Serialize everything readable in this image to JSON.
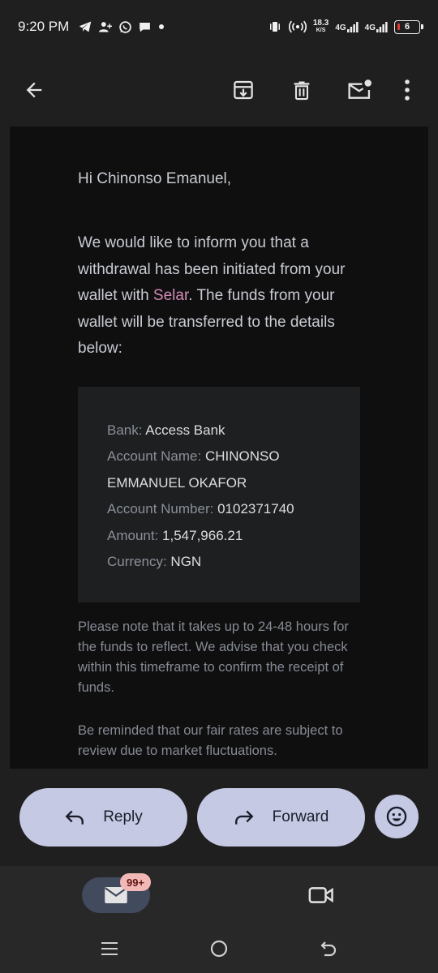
{
  "status_bar": {
    "time": "9:20 PM",
    "net_speed_value": "18.3",
    "net_speed_unit": "K/S",
    "network_1": "4G",
    "network_2": "4G",
    "battery_level": "6",
    "icons": [
      "telegram-icon",
      "person-add-icon",
      "whatsapp-icon",
      "chat-icon",
      "dot-icon",
      "vibrate-icon",
      "hotspot-icon",
      "signal-icon",
      "battery-icon"
    ]
  },
  "app_bar": {
    "icons": [
      "back-arrow-icon",
      "archive-icon",
      "delete-icon",
      "mark-unread-icon",
      "more-vert-icon"
    ]
  },
  "email": {
    "greeting": "Hi Chinonso Emanuel,",
    "intro_part1": "We would like to inform you that a withdrawal has been initiated from your wallet with ",
    "brand": "Selar",
    "intro_part2": ". The funds from your wallet will be transferred to the details below:",
    "details": {
      "bank_label": "Bank:",
      "bank_value": "Access Bank",
      "account_name_label": "Account Name:",
      "account_name_value": "CHINONSO EMMANUEL OKAFOR",
      "account_number_label": "Account Number:",
      "account_number_value": "0102371740",
      "amount_label": "Amount:",
      "amount_value": "1,547,966.21",
      "currency_label": "Currency:",
      "currency_value": "NGN"
    },
    "note": "Please note that it takes up to 24-48 hours for the funds to reflect. We advise that you check within this timeframe to confirm the receipt of funds.",
    "note2": "Be reminded that our fair rates are subject to review due to market fluctuations."
  },
  "actions": {
    "reply_label": "Reply",
    "forward_label": "Forward"
  },
  "bottom_nav": {
    "mail_badge": "99+"
  },
  "colors": {
    "brand_link": "#d48ab6",
    "pill_bg": "#c5c9e3",
    "email_bg": "#0f0f0f",
    "details_bg": "#1e1f21",
    "badge_bg": "#f2b8b5"
  }
}
